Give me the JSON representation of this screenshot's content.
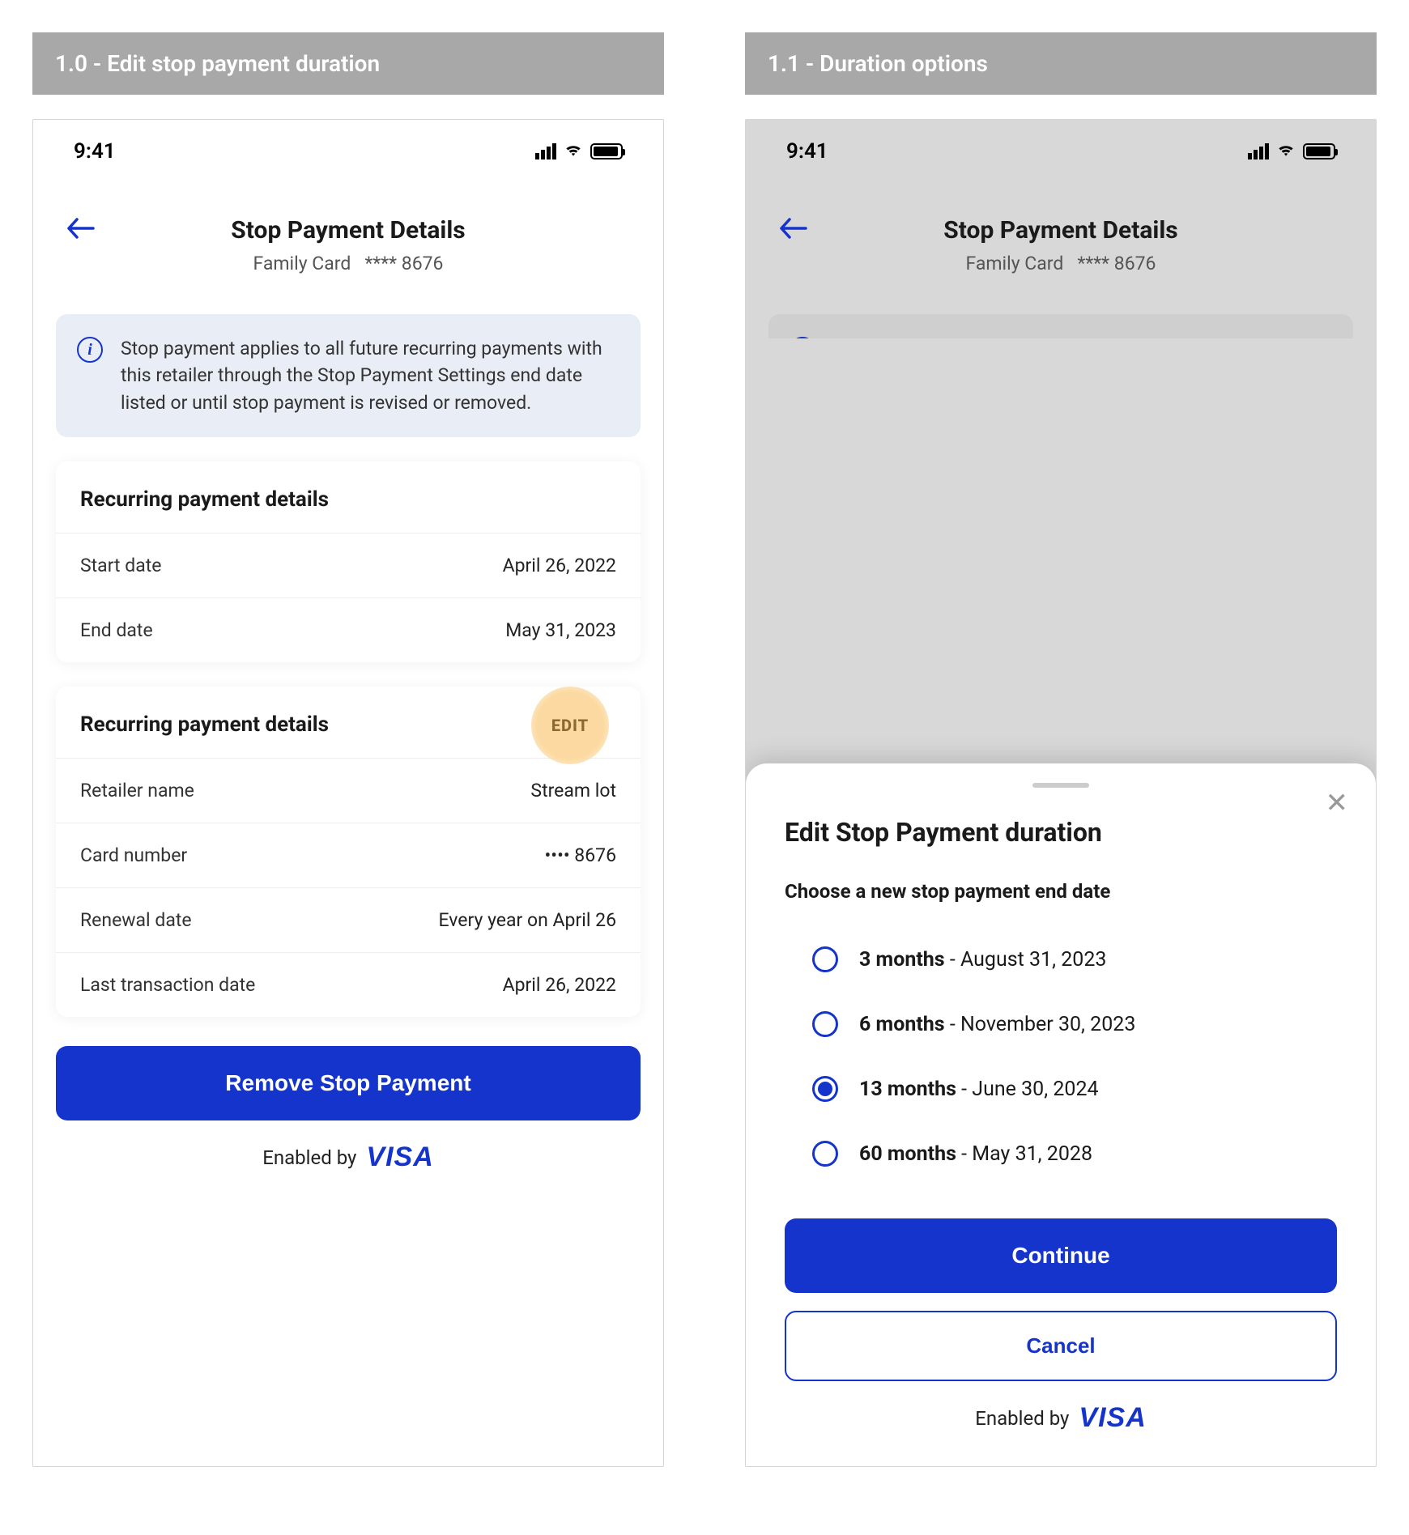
{
  "screens": {
    "left": {
      "header": "1.0 - Edit stop payment duration"
    },
    "right": {
      "header": "1.1 - Duration options"
    }
  },
  "status": {
    "time": "9:41"
  },
  "nav": {
    "title": "Stop Payment Details",
    "card_name": "Family Card",
    "card_mask": "**** 8676"
  },
  "banner": {
    "text": "Stop payment applies to all future recurring payments with this retailer through the Stop Payment Settings end date listed or until stop payment is revised or removed."
  },
  "section_dates": {
    "title": "Recurring payment details",
    "rows": [
      {
        "label": "Start date",
        "value": "April 26, 2022"
      },
      {
        "label": "End date",
        "value": "May 31, 2023"
      }
    ]
  },
  "section_retailer": {
    "title": "Recurring payment details",
    "rows": [
      {
        "label": "Retailer name",
        "value": "Stream lot"
      },
      {
        "label": "Card number",
        "value": "•••• 8676"
      },
      {
        "label": "Renewal date",
        "value": "Every year on April 26"
      },
      {
        "label": "Last transaction date",
        "value": "April 26, 2022"
      }
    ]
  },
  "buttons": {
    "remove": "Remove Stop Payment",
    "continue": "Continue",
    "cancel": "Cancel"
  },
  "enabled_by": {
    "label": "Enabled by",
    "brand": "VISA"
  },
  "edit_badge": "EDIT",
  "sheet": {
    "title": "Edit Stop Payment duration",
    "subtitle": "Choose a new stop payment end date",
    "options": [
      {
        "label_bold": "3 months",
        "label_rest": " - August 31, 2023",
        "selected": false
      },
      {
        "label_bold": "6 months",
        "label_rest": " - November 30, 2023",
        "selected": false
      },
      {
        "label_bold": "13 months",
        "label_rest": " -  June 30, 2024",
        "selected": true
      },
      {
        "label_bold": "60 months",
        "label_rest": " - May 31, 2028",
        "selected": false
      }
    ]
  }
}
